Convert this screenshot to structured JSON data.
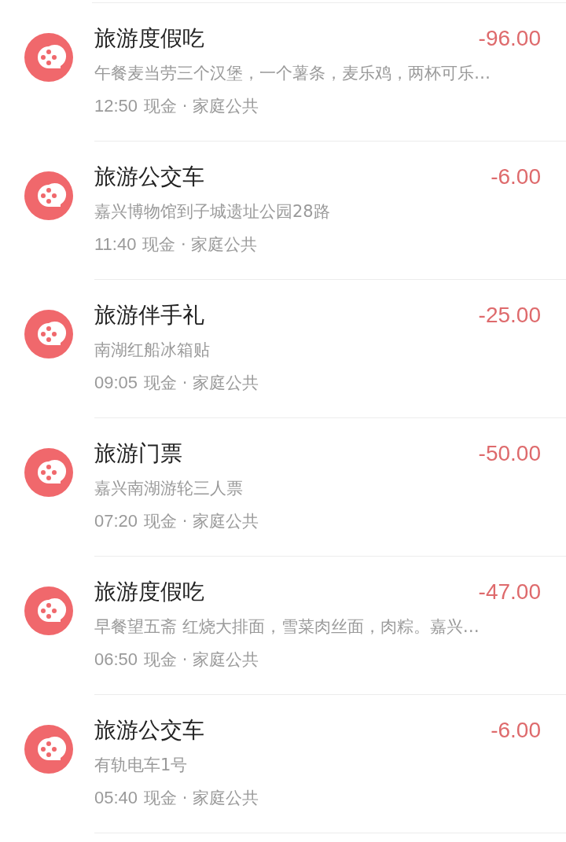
{
  "transactions": [
    {
      "category": "旅游度假吃",
      "amount": "-96.00",
      "note": "午餐麦当劳三个汉堡，一个薯条，麦乐鸡，两杯可乐…",
      "time": "12:50",
      "account": "现金 · 家庭公共"
    },
    {
      "category": "旅游公交车",
      "amount": "-6.00",
      "note": "嘉兴博物馆到子城遗址公园28路",
      "time": "11:40",
      "account": "现金 · 家庭公共"
    },
    {
      "category": "旅游伴手礼",
      "amount": "-25.00",
      "note": "南湖红船冰箱贴",
      "time": "09:05",
      "account": "现金 · 家庭公共"
    },
    {
      "category": "旅游门票",
      "amount": "-50.00",
      "note": "嘉兴南湖游轮三人票",
      "time": "07:20",
      "account": "现金 · 家庭公共"
    },
    {
      "category": "旅游度假吃",
      "amount": "-47.00",
      "note": "早餐望五斋 红烧大排面，雪菜肉丝面，肉粽。嘉兴…",
      "time": "06:50",
      "account": "现金 · 家庭公共"
    },
    {
      "category": "旅游公交车",
      "amount": "-6.00",
      "note": "有轨电车1号",
      "time": "05:40",
      "account": "现金 · 家庭公共"
    }
  ]
}
